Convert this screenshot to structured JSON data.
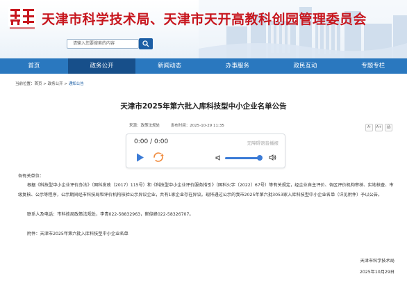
{
  "header": {
    "site_title": "天津市科学技术局、天津市天开高教科创园管理委员会",
    "logo_text": "天津科技",
    "search_placeholder": "请输入您要搜索的内容"
  },
  "nav": {
    "items": [
      {
        "label": "首页",
        "active": false
      },
      {
        "label": "政务公开",
        "active": true
      },
      {
        "label": "新闻动态",
        "active": false
      },
      {
        "label": "办事服务",
        "active": false
      },
      {
        "label": "政民互动",
        "active": false
      },
      {
        "label": "专题专栏",
        "active": false
      }
    ]
  },
  "breadcrumb": {
    "prefix": "当前位置：",
    "items": [
      "首页",
      "政务公开",
      "通知公告"
    ],
    "separator": " > "
  },
  "article": {
    "title": "天津市2025年第六批入库科技型中小企业名单公告",
    "source": "来源：政策法规处",
    "published": "发布时间：2025-10-29 11:35",
    "greeting": "各有关单位：",
    "paragraph1": "根据《科技型中小企业评价办法》（国科发政〔2017〕115号）和《科技型中小企业评价服务指引》（国科火字〔2022〕67号）等有关规定，经企业自主评价、各区评价机构审核、实地核查、市级复核、公示等程序，公示期间经市科技局和评价机构核验公示异议企业，共有1家企业存在异议。现将通过公示的我市2025年第六批3053家入库科技型中小企业名单（详见附件）予以公告。",
    "contact": "联系人及电话：市科技局政策法规处，李青022-58832963，崔俊峰022-58326707。",
    "attachment": "附件：天津市2025年第六批入库科技型中小企业名单",
    "signature": "天津市科学技术局",
    "date": "2025年10月29日"
  },
  "font_tools": [
    "A-",
    "A+",
    "🖨"
  ],
  "player": {
    "time": "0:00 / 0:00",
    "notice": "无障碍语音播报",
    "volume_level": 0.85
  },
  "colors": {
    "brand_red": "#c7161e",
    "nav_blue": "#2a78bf",
    "nav_active": "#174f8a",
    "accent_blue": "#3b7bd6"
  }
}
